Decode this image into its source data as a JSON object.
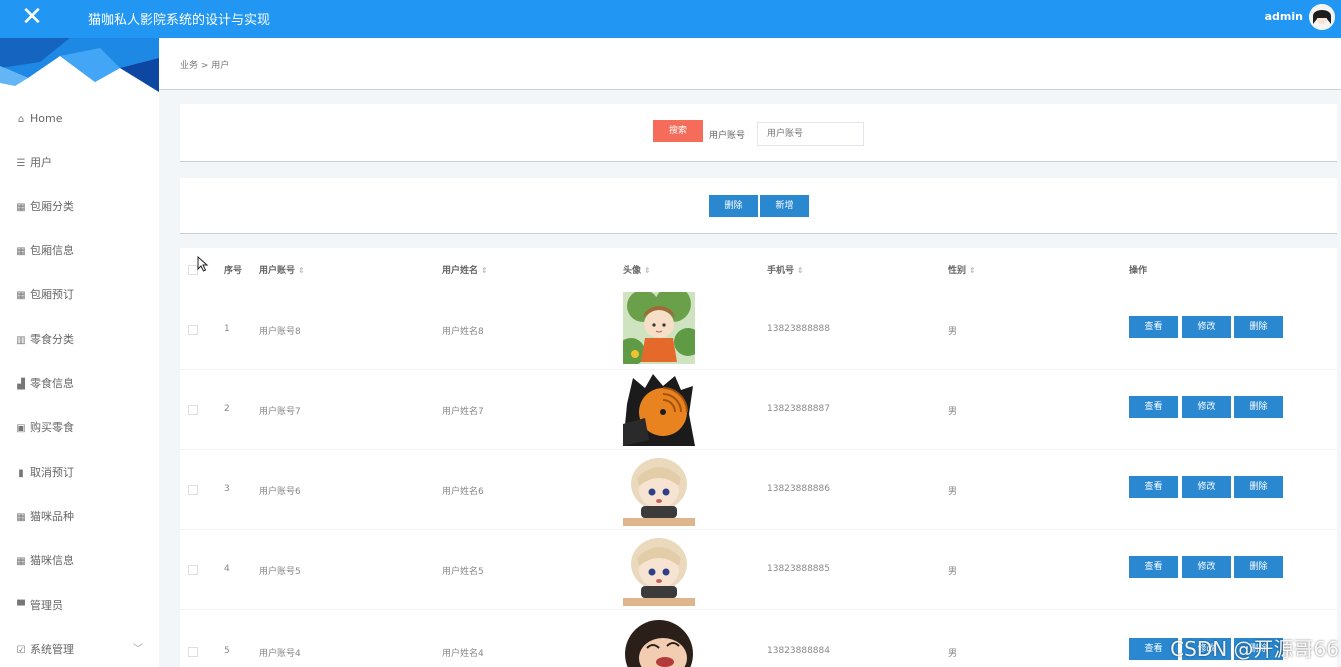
{
  "header": {
    "close_label": "✕",
    "title": "猫咖私人影院系统的设计与实现",
    "username": "admin"
  },
  "sidebar": {
    "items": [
      {
        "label": "Home",
        "icon": "home-icon",
        "glyph": "⌂"
      },
      {
        "label": "用户",
        "icon": "list-icon",
        "glyph": "☰"
      },
      {
        "label": "包厢分类",
        "icon": "grid-icon",
        "glyph": "▦"
      },
      {
        "label": "包厢信息",
        "icon": "grid-icon",
        "glyph": "▦"
      },
      {
        "label": "包厢预订",
        "icon": "grid-icon",
        "glyph": "▦"
      },
      {
        "label": "零食分类",
        "icon": "books-icon",
        "glyph": "▥"
      },
      {
        "label": "零食信息",
        "icon": "thumbs-up-icon",
        "glyph": "▟"
      },
      {
        "label": "购买零食",
        "icon": "clipboard-icon",
        "glyph": "▣"
      },
      {
        "label": "取消预订",
        "icon": "bar-chart-icon",
        "glyph": "▮"
      },
      {
        "label": "猫咪品种",
        "icon": "grid-icon",
        "glyph": "▦"
      },
      {
        "label": "猫咪信息",
        "icon": "grid-icon",
        "glyph": "▦"
      },
      {
        "label": "管理员",
        "icon": "monitor-icon",
        "glyph": "▀"
      },
      {
        "label": "系统管理",
        "icon": "check-square-icon",
        "glyph": "☑",
        "chevron": "﹀"
      }
    ]
  },
  "breadcrumb": "业务 > 用户",
  "search": {
    "button_label": "搜索",
    "field_label": "用户账号",
    "placeholder": "用户账号"
  },
  "actions": {
    "delete_label": "删除",
    "add_label": "新增"
  },
  "table": {
    "headers": {
      "index": "序号",
      "account": "用户账号",
      "name": "用户姓名",
      "avatar": "头像",
      "phone": "手机号",
      "gender": "性别",
      "ops": "操作"
    },
    "sort_glyph": "⇕",
    "rows": [
      {
        "index": "1",
        "account": "用户账号8",
        "name": "用户姓名8",
        "phone": "13823888888",
        "gender": "男",
        "avatar": "cartoon-boy-green-avatar"
      },
      {
        "index": "2",
        "account": "用户账号7",
        "name": "用户姓名7",
        "phone": "13823888887",
        "gender": "男",
        "avatar": "orange-mask-ninja-avatar"
      },
      {
        "index": "3",
        "account": "用户账号6",
        "name": "用户姓名6",
        "phone": "13823888886",
        "gender": "男",
        "avatar": "blonde-chibi-avatar"
      },
      {
        "index": "4",
        "account": "用户账号5",
        "name": "用户姓名5",
        "phone": "13823888885",
        "gender": "男",
        "avatar": "blonde-chibi-avatar"
      },
      {
        "index": "5",
        "account": "用户账号4",
        "name": "用户姓名4",
        "phone": "13823888884",
        "gender": "男",
        "avatar": "laughing-face-avatar"
      }
    ],
    "row_buttons": {
      "view": "查看",
      "edit": "修改",
      "delete": "删除"
    }
  },
  "watermark": "CSDN @开源哥66",
  "colors": {
    "topbar": "#2196f3",
    "primary_button": "#2a88d0",
    "search_button": "#f56c5a"
  }
}
